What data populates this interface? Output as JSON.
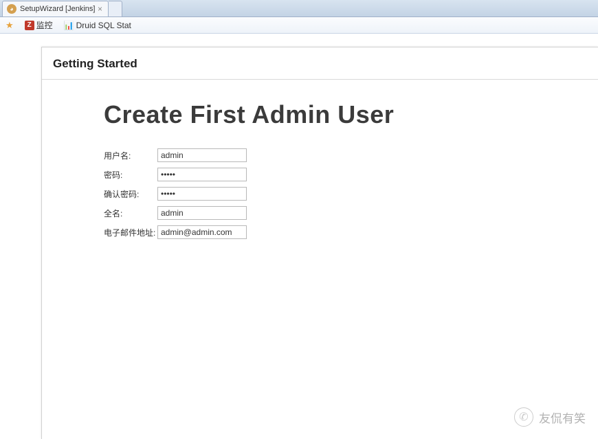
{
  "browser": {
    "tab_title": "SetupWizard [Jenkins]",
    "bookmarks": [
      {
        "label": "",
        "icon": "star"
      },
      {
        "label": "监控",
        "icon": "z"
      },
      {
        "label": "Druid SQL Stat",
        "icon": "chart"
      }
    ]
  },
  "setup": {
    "header": "Getting Started",
    "title": "Create First Admin User",
    "fields": {
      "username": {
        "label": "用户名:",
        "value": "admin"
      },
      "password": {
        "label": "密码:",
        "value": "•••••"
      },
      "confirm": {
        "label": "确认密码:",
        "value": "•••••"
      },
      "fullname": {
        "label": "全名:",
        "value": "admin"
      },
      "email": {
        "label": "电子邮件地址:",
        "value": "admin@admin.com"
      }
    }
  },
  "watermark": {
    "text": "友侃有笑"
  }
}
